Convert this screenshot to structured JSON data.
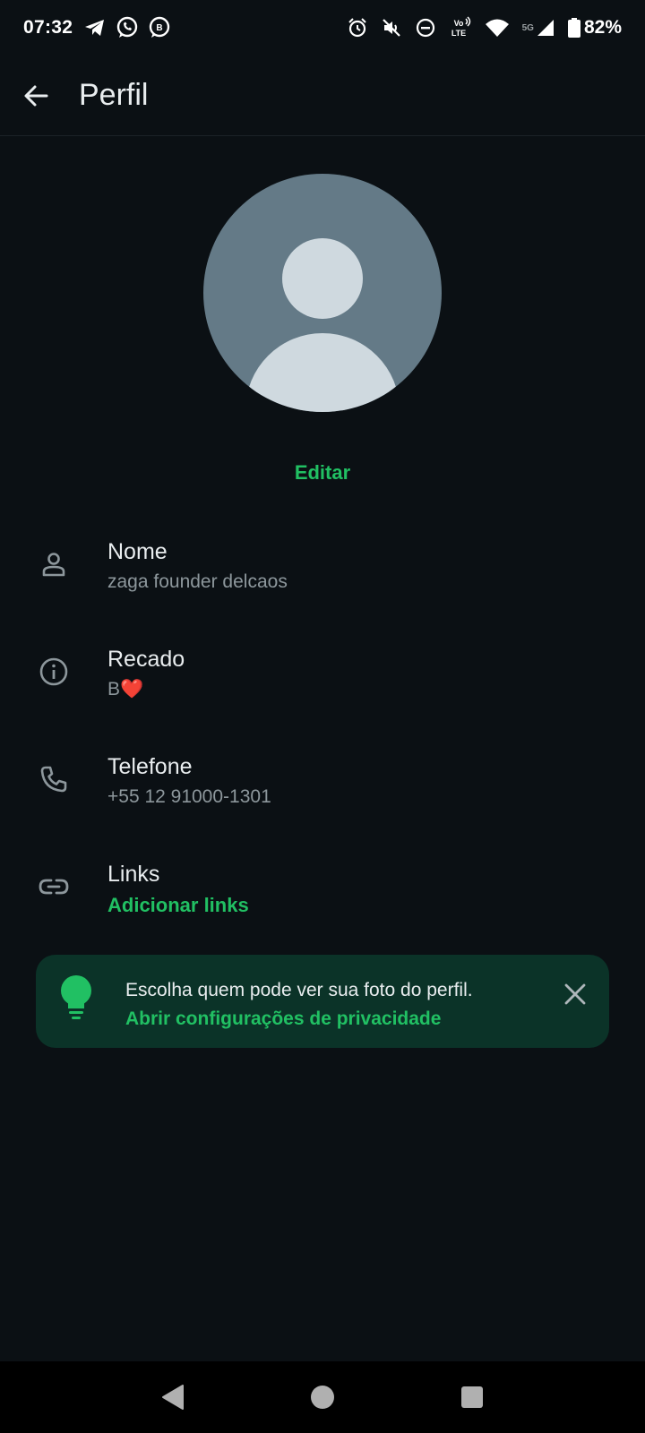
{
  "status_bar": {
    "time": "07:32",
    "battery": "82%",
    "network": "5G",
    "volte": "Vo LTE",
    "left_icons": [
      "telegram-icon",
      "whatsapp-icon",
      "whatsapp-business-icon"
    ],
    "right_icons": [
      "alarm-icon",
      "vibrate-off-icon",
      "do-not-disturb-icon",
      "volte-icon",
      "wifi-icon",
      "signal-icon",
      "battery-icon"
    ]
  },
  "header": {
    "title": "Perfil"
  },
  "profile": {
    "edit_label": "Editar"
  },
  "fields": {
    "name": {
      "label": "Nome",
      "value": "zaga founder delcaos"
    },
    "about": {
      "label": "Recado",
      "value": "B❤️"
    },
    "phone": {
      "label": "Telefone",
      "value": "+55 12 91000-1301"
    },
    "links": {
      "label": "Links",
      "value": "Adicionar links"
    }
  },
  "privacy_banner": {
    "text": "Escolha quem pode ver sua foto do perfil.",
    "link": "Abrir configurações de privacidade"
  },
  "colors": {
    "background": "#0b1014",
    "accent": "#21c063",
    "banner_bg": "#0b3328",
    "avatar_bg": "#647a87",
    "secondary_text": "#8d979c"
  }
}
